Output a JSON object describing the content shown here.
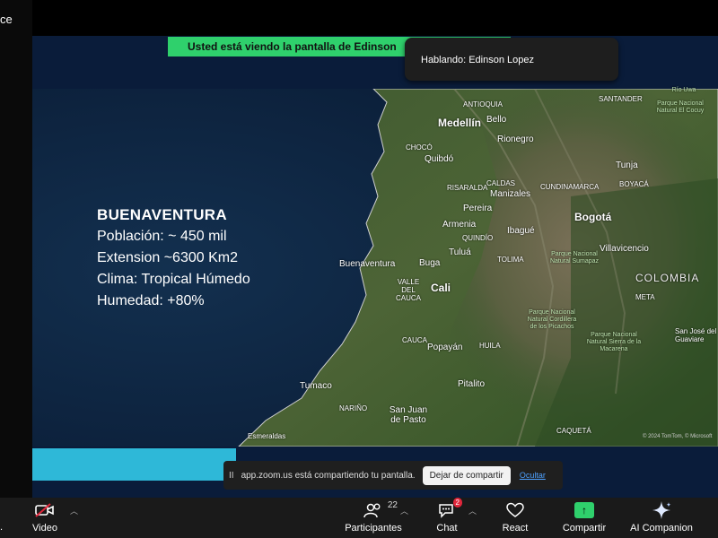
{
  "window": {
    "title_fragment": "ce"
  },
  "share_banner": {
    "text": "Usted está viendo la pantalla de  Edinson"
  },
  "speaking": {
    "text": "Hablando: Edinson Lopez"
  },
  "slide": {
    "title": "BUENAVENTURA",
    "lines": [
      "Población: ~ 450 mil",
      "Extension ~6300 Km2",
      "Clima: Tropical Húmedo",
      "Humedad: +80%"
    ]
  },
  "map": {
    "cities": {
      "medellin": "Medellín",
      "bello": "Bello",
      "rionegro": "Rionegro",
      "quibdo": "Quibdó",
      "manizales": "Manizales",
      "pereira": "Pereira",
      "armenia": "Armenia",
      "ibague": "Ibagué",
      "bogota": "Bogotá",
      "tunja": "Tunja",
      "villavicencio": "Villavicencio",
      "buenaventura": "Buenaventura",
      "buga": "Buga",
      "tulua": "Tuluá",
      "cali": "Cali",
      "popayan": "Popayán",
      "tumaco": "Tumaco",
      "pitalito": "Pitalito",
      "pasto": "San Juan de Pasto",
      "esmeraldas": "Esmeraldas",
      "sanjose": "San José del Guaviare"
    },
    "regions": {
      "antioquia": "ANTIOQUIA",
      "choco": "CHOCÓ",
      "risaralda": "RISARALDA",
      "caldas": "CALDAS",
      "cundinamarca": "CUNDINAMARCA",
      "quindio": "QUINDÍO",
      "tolima": "TOLIMA",
      "valle": "VALLE DEL CAUCA",
      "cauca": "CAUCA",
      "huila": "HUILA",
      "narino": "NARIÑO",
      "santander": "SANTANDER",
      "boyaca": "BOYACÁ",
      "meta": "META",
      "caqueta": "CAQUETÁ"
    },
    "parks": {
      "cocuy": "Parque Nacional Natural El Cocuy",
      "sumapaz": "Parque Nacional Natural Sumapaz",
      "picachos": "Parque Nacional Natural Cordillera de los Picachos",
      "macarena": "Parque Nacional Natural Sierra de la Macarena",
      "uwa": "Río Uwa"
    },
    "country": "COLOMBIA",
    "attribution": "© 2024 TomTom, © Microsoft"
  },
  "notification": {
    "pause": "II",
    "text": "app.zoom.us está compartiendo tu pantalla.",
    "stop_label": "Dejar de compartir",
    "hide_label": "Ocultar"
  },
  "toolbar": {
    "video_label": "Video",
    "participants_label": "Participantes",
    "participants_count": "22",
    "chat_label": "Chat",
    "chat_badge": "2",
    "react_label": "React",
    "share_label": "Compartir",
    "ai_label": "AI Companion",
    "left_dot": "."
  },
  "colors": {
    "share_banner": "#2fd06c",
    "accent_bar": "#2eb8d8",
    "ocean": "#0b1e3c",
    "badge": "#e0263b"
  }
}
